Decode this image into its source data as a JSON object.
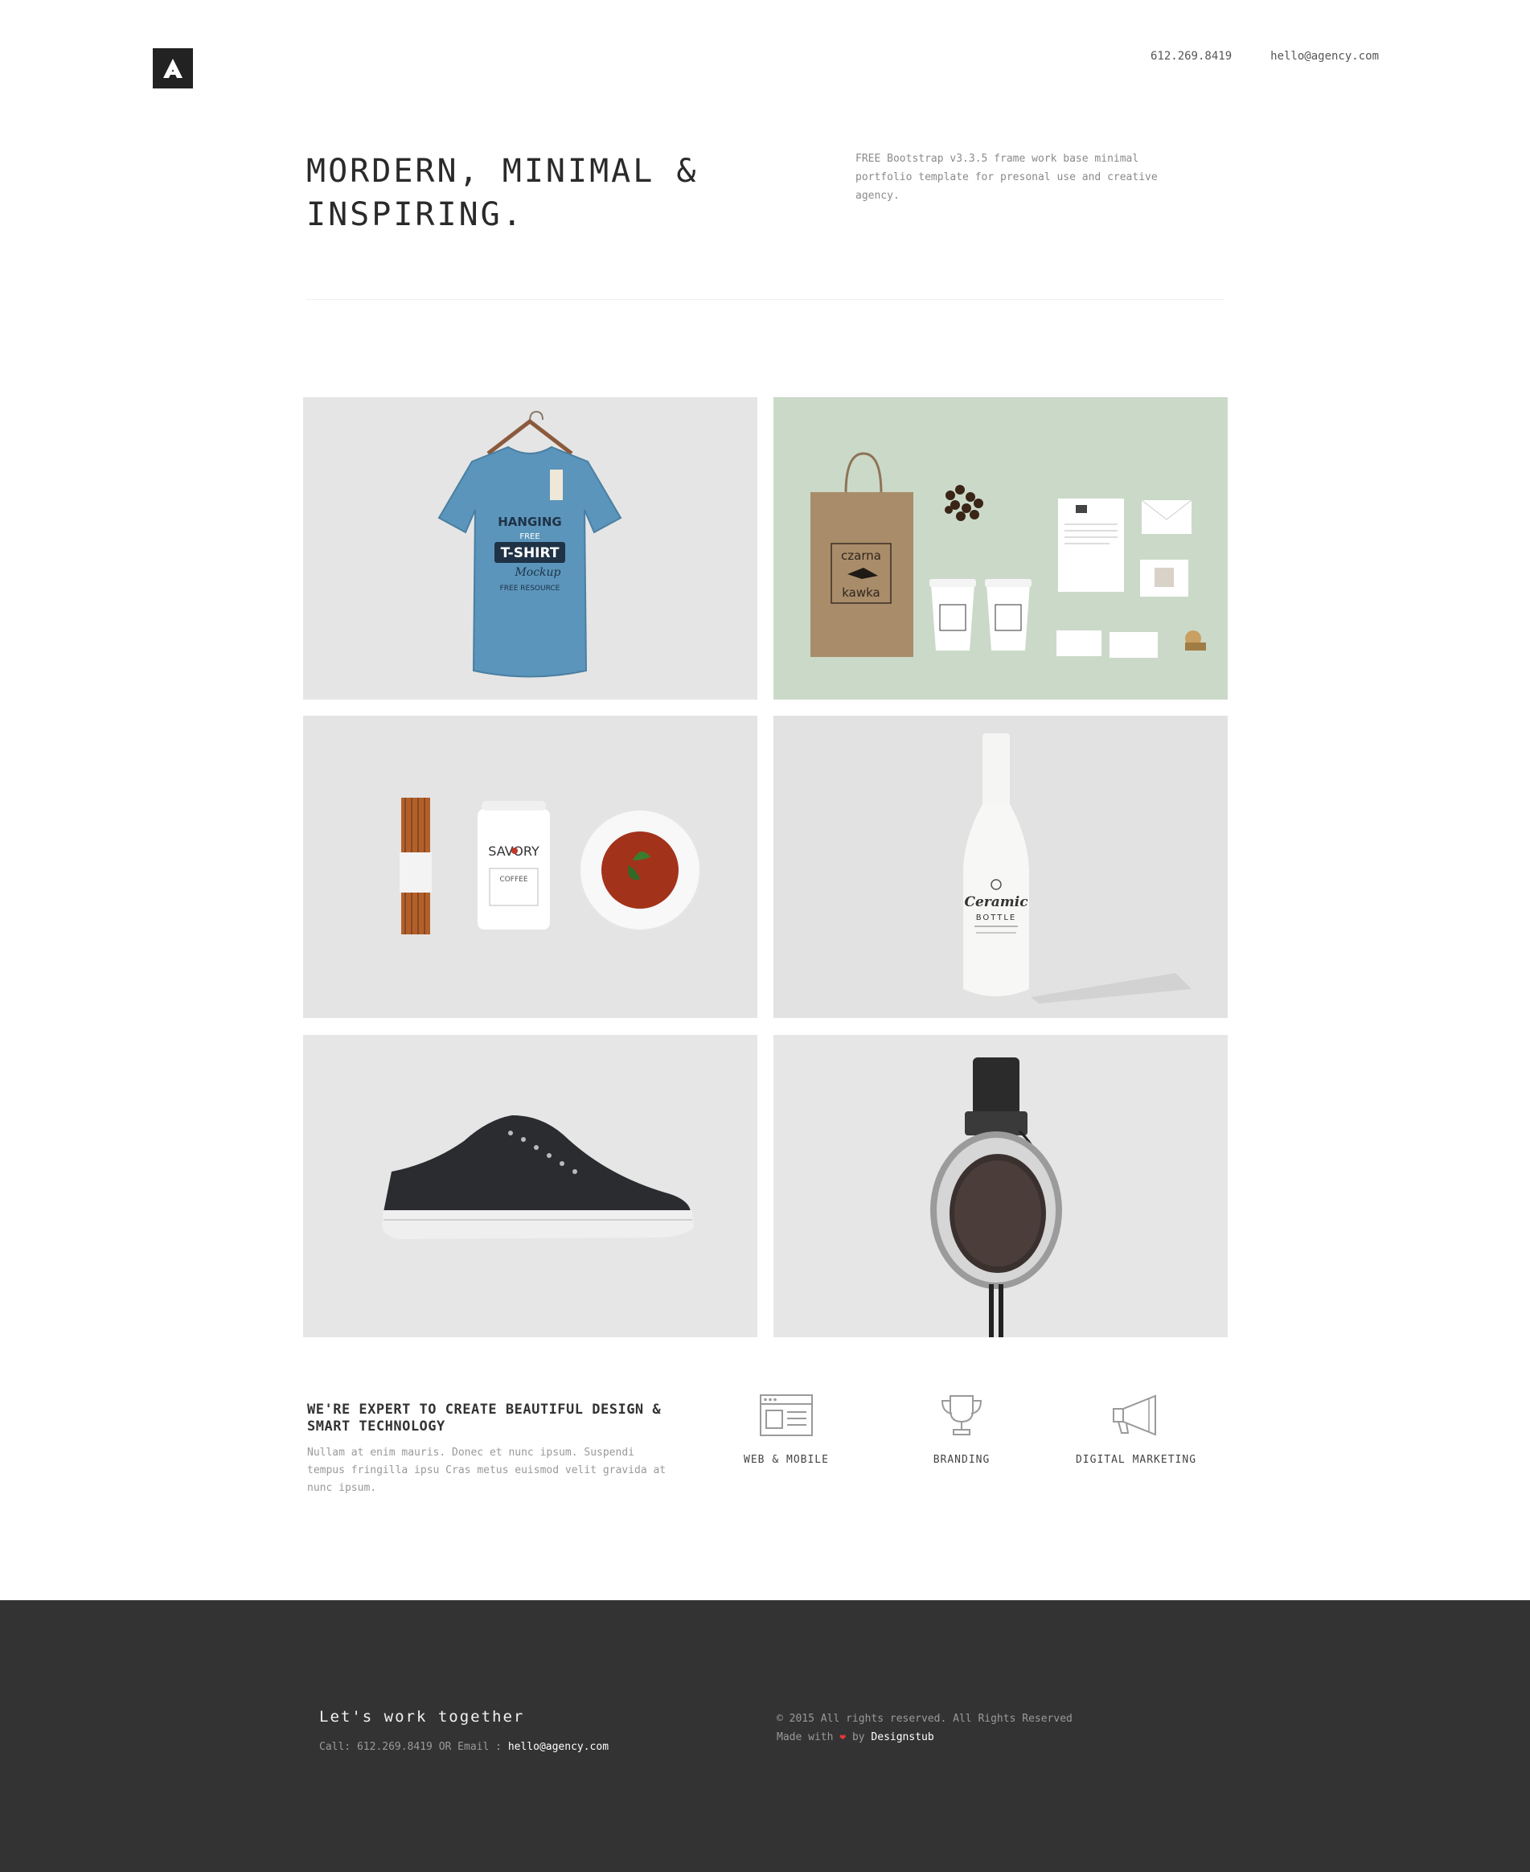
{
  "header": {
    "logo_letter": "A",
    "phone": "612.269.8419",
    "email": "hello@agency.com"
  },
  "hero": {
    "title_line1": "MORDERN, MINIMAL &",
    "title_line2": "INSPIRING.",
    "description": "FREE Bootstrap v3.3.5 frame work base minimal portfolio template for presonal use and creative agency."
  },
  "gallery": {
    "items": [
      {
        "icon": "tshirt-mockup",
        "text1": "HANGING",
        "text2": "FREE",
        "text3": "T-SHIRT",
        "text4": "Mockup",
        "text5": "FREE RESOURCE"
      },
      {
        "icon": "coffee-branding-mockup",
        "text1": "czarna",
        "text2": "kawka"
      },
      {
        "icon": "food-packaging-mockup",
        "text1": "SAVORY",
        "text2": "COFFEE"
      },
      {
        "icon": "ceramic-bottle-mockup",
        "text1": "Ceramic",
        "text2": "BOTTLE"
      },
      {
        "icon": "sneaker-photo"
      },
      {
        "icon": "headphones-photo"
      }
    ]
  },
  "services": {
    "title": "WE'RE EXPERT TO CREATE BEAUTIFUL DESIGN & SMART TECHNOLOGY",
    "text": "Nullam at enim mauris. Donec et nunc ipsum. Suspendi tempus fringilla ipsu Cras metus euismod velit gravida at nunc ipsum.",
    "items": [
      {
        "label": "WEB & MOBILE",
        "icon": "browser-window-icon"
      },
      {
        "label": "BRANDING",
        "icon": "trophy-icon"
      },
      {
        "label": "DIGITAL MARKETING",
        "icon": "megaphone-icon"
      }
    ]
  },
  "footer": {
    "title": "Let's work together",
    "call_prefix": "Call: 612.269.8419 OR Email : ",
    "call_email": "hello@agency.com",
    "copyright": "© 2015 All rights reserved. All Rights Reserved",
    "made_with": "Made with",
    "heart": "❤",
    "by": "by",
    "credit": "Designstub"
  },
  "colors": {
    "footer_bg": "#333333",
    "logo_bg": "#222222",
    "heart": "#e53935",
    "tile_green": "#cbd9c9"
  }
}
